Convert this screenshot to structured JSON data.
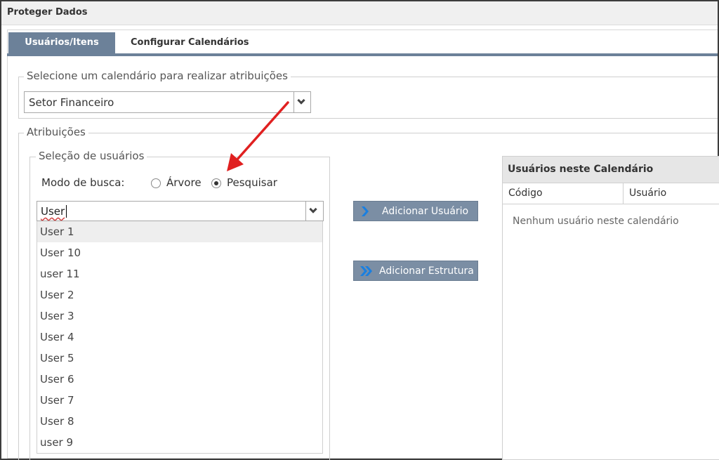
{
  "window": {
    "title": "Proteger Dados"
  },
  "tabs": [
    {
      "label": "Usuários/Itens",
      "active": true
    },
    {
      "label": "Configurar Calendários",
      "active": false
    }
  ],
  "calendar_section": {
    "legend": "Selecione um calendário para realizar atribuições",
    "selected": "Setor Financeiro"
  },
  "assignments": {
    "legend": "Atribuições",
    "user_selection": {
      "legend": "Seleção de usuários",
      "search_mode_label": "Modo de busca:",
      "options": [
        {
          "label": "Árvore",
          "checked": false
        },
        {
          "label": "Pesquisar",
          "checked": true
        }
      ],
      "search_value": "User",
      "results": [
        "User 1",
        "User 10",
        "user 11",
        "User 2",
        "User 3",
        "User 4",
        "User 5",
        "User 6",
        "User 7",
        "User 8",
        "user 9"
      ]
    },
    "buttons": {
      "add_user": "Adicionar Usuário",
      "add_structure": "Adicionar Estrutura"
    },
    "calendar_users": {
      "title": "Usuários neste Calendário",
      "columns": [
        "Código",
        "Usuário"
      ],
      "empty_message": "Nenhum usuário neste calendário"
    }
  },
  "colors": {
    "tab_active": "#6c8199",
    "button": "#7b8ea4",
    "icon_blue": "#1a7fe0",
    "annotation_arrow": "#e02020"
  }
}
